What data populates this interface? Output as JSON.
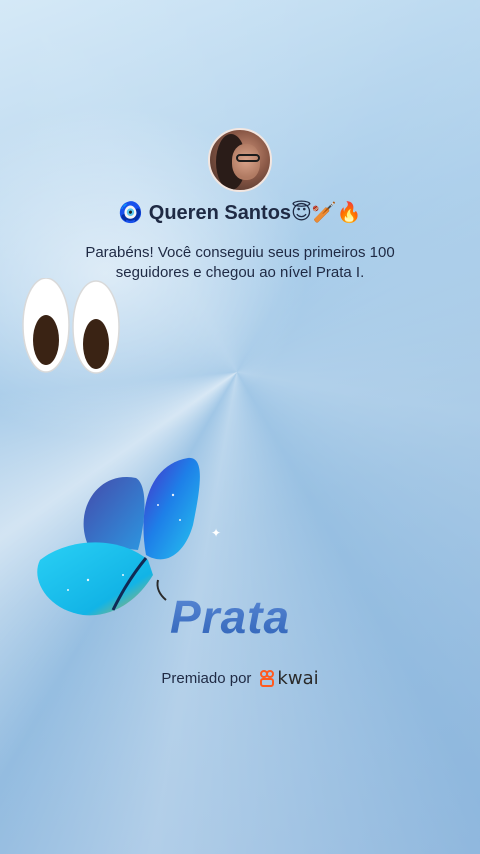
{
  "profile": {
    "name": "🧿 Queren Santos😇🏏🔥"
  },
  "message": "Parabéns! Você conseguiu seus primeiros 100 seguidores e chegou ao nível Prata I.",
  "level": "Prata",
  "awarded": {
    "prefix": "Premiado por",
    "brand": "kwai"
  },
  "colors": {
    "text": "#1f2a44",
    "level": "#3a6fc4",
    "brand": "#ff5a1f"
  },
  "decor": {
    "eyes": "eyes-emoji",
    "butterfly": "blue-butterfly",
    "sparkle": "sparkle-icon"
  }
}
